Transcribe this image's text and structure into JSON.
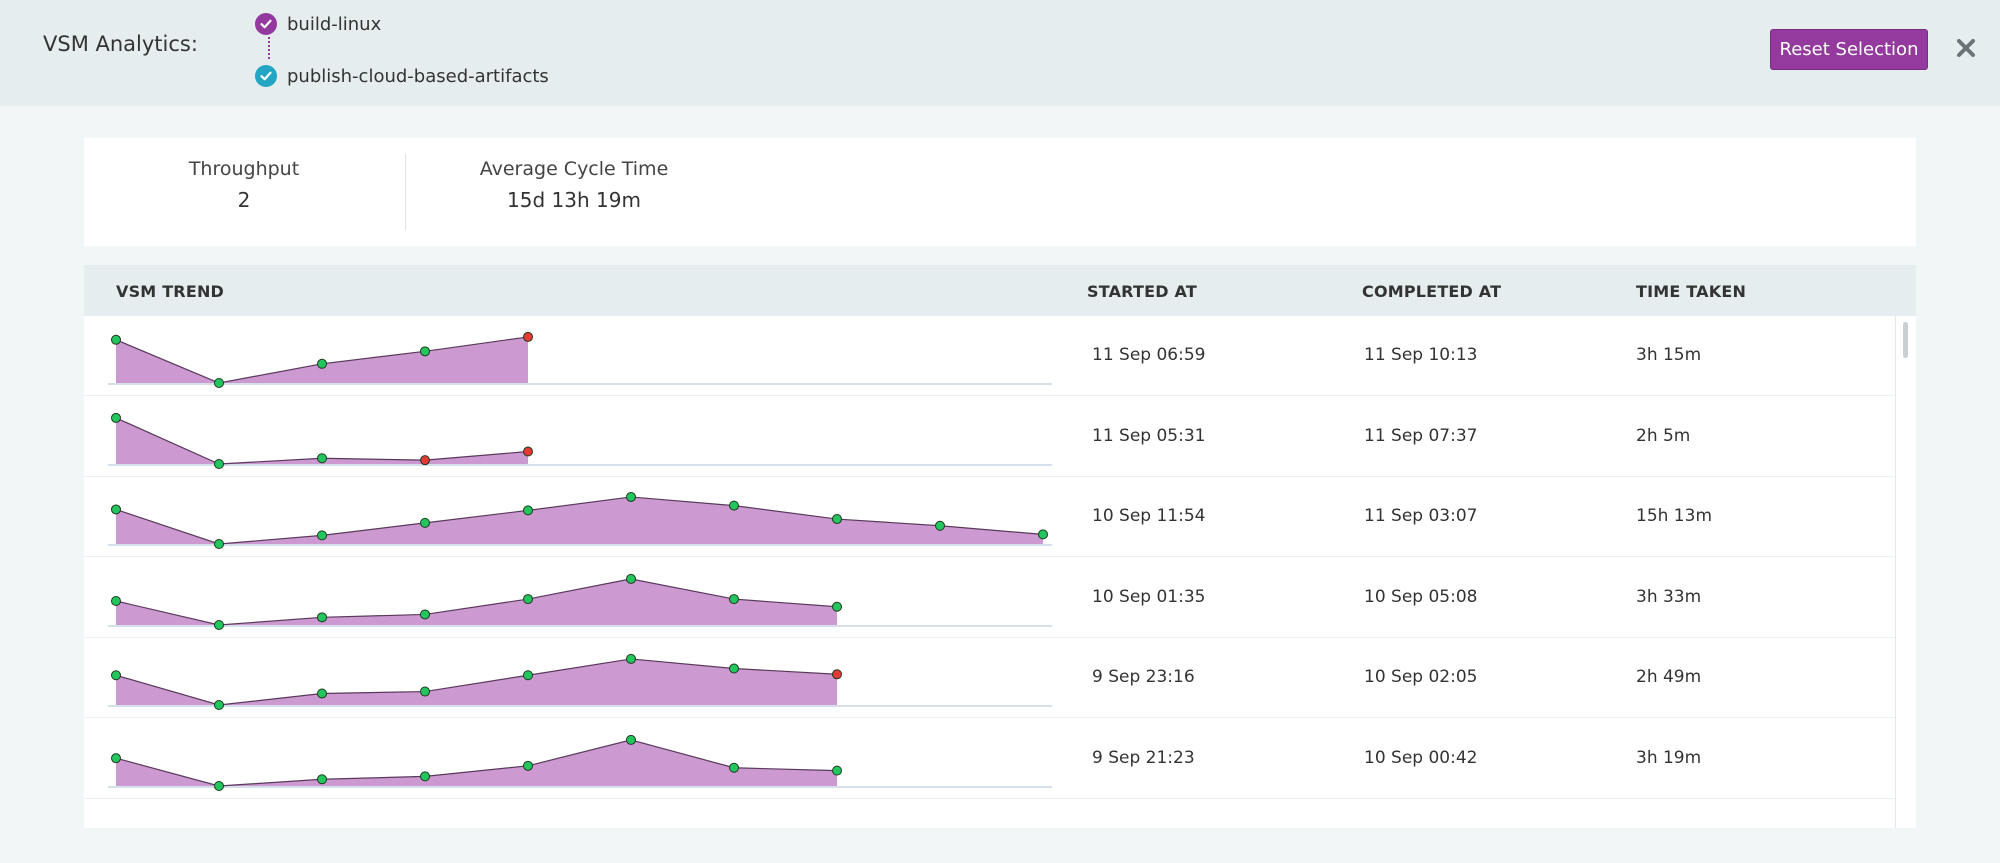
{
  "header": {
    "title": "VSM Analytics:",
    "stages": [
      "build-linux",
      "publish-cloud-based-artifacts"
    ],
    "reset_label": "Reset Selection"
  },
  "summary": {
    "throughput_label": "Throughput",
    "throughput_value": "2",
    "cycle_label": "Average Cycle Time",
    "cycle_value": "15d 13h 19m"
  },
  "table": {
    "columns": [
      "VSM TREND",
      "STARTED AT",
      "COMPLETED AT",
      "TIME TAKEN"
    ],
    "rows": [
      {
        "started": "11 Sep 06:59",
        "completed": "11 Sep 10:13",
        "taken": "3h 15m",
        "trend": [
          45,
          0,
          20,
          33,
          48
        ],
        "status": [
          "ok",
          "ok",
          "ok",
          "ok",
          "fail"
        ]
      },
      {
        "started": "11 Sep 05:31",
        "completed": "11 Sep 07:37",
        "taken": "2h 5m",
        "trend": [
          48,
          0,
          6,
          4,
          13
        ],
        "status": [
          "ok",
          "ok",
          "ok",
          "fail",
          "fail"
        ]
      },
      {
        "started": "10 Sep 11:54",
        "completed": "11 Sep 03:07",
        "taken": "15h 13m",
        "trend": [
          36,
          0,
          9,
          22,
          35,
          49,
          40,
          26,
          19,
          10
        ],
        "status": [
          "ok",
          "ok",
          "ok",
          "ok",
          "ok",
          "ok",
          "ok",
          "ok",
          "ok",
          "ok"
        ]
      },
      {
        "started": "10 Sep 01:35",
        "completed": "10 Sep 05:08",
        "taken": "3h 33m",
        "trend": [
          25,
          0,
          8,
          11,
          27,
          48,
          27,
          19
        ],
        "status": [
          "ok",
          "ok",
          "ok",
          "ok",
          "ok",
          "ok",
          "ok",
          "ok"
        ]
      },
      {
        "started": "9 Sep 23:16",
        "completed": "10 Sep 02:05",
        "taken": "2h 49m",
        "trend": [
          31,
          0,
          12,
          14,
          31,
          48,
          38,
          32
        ],
        "status": [
          "ok",
          "ok",
          "ok",
          "ok",
          "ok",
          "ok",
          "ok",
          "fail"
        ]
      },
      {
        "started": "9 Sep 21:23",
        "completed": "10 Sep 00:42",
        "taken": "3h 19m",
        "trend": [
          29,
          0,
          7,
          10,
          21,
          48,
          19,
          16
        ],
        "status": [
          "ok",
          "ok",
          "ok",
          "ok",
          "ok",
          "ok",
          "ok",
          "ok"
        ]
      }
    ]
  },
  "colors": {
    "accent": "#943a9e",
    "teal": "#23a6c4",
    "area_fill": "#cc99d1",
    "ok_point": "#22c55e",
    "fail_point": "#e53935"
  },
  "icons": {
    "stage_1": "check-circle-icon",
    "stage_2": "check-circle-icon",
    "close": "close-icon"
  }
}
